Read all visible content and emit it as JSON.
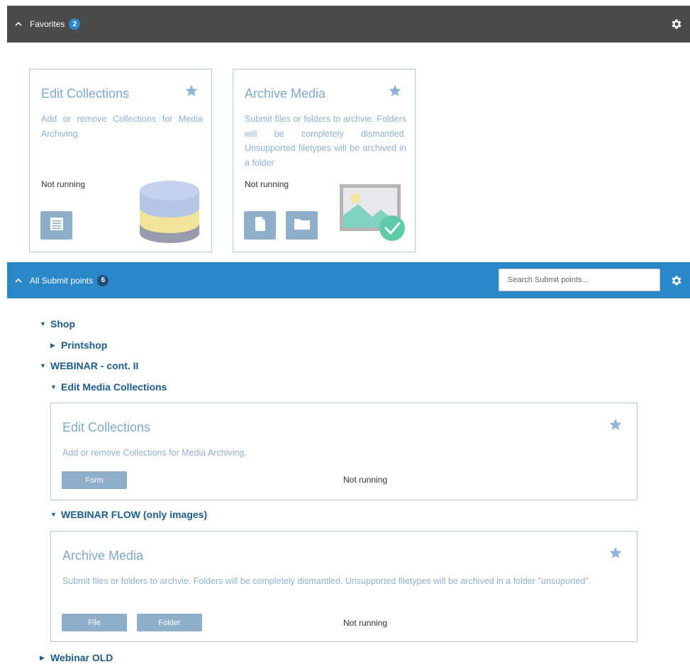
{
  "favorites": {
    "title": "Favorites",
    "count": "2",
    "cards": [
      {
        "title": "Edit Collections",
        "description": "Add or remove Collections for Media Archiving.",
        "status": "Not running",
        "icons": [
          "form-icon"
        ],
        "illustration": "database-illustration"
      },
      {
        "title": "Archive Media",
        "description": "Submit files or folders to archvie. Folders will be completely dismantled. Unsupported filetypes will be archived in a folder",
        "status": "Not running",
        "icons": [
          "file-icon",
          "folder-icon"
        ],
        "illustration": "image-check-illustration"
      }
    ]
  },
  "all": {
    "title": "All Submit points",
    "count": "6",
    "search_placeholder": "Search Submit points..."
  },
  "tree": {
    "shop": "Shop",
    "printshop": "Printshop",
    "webinar_cont": "WEBINAR - cont. II",
    "edit_media_collections": "Edit Media Collections",
    "webinar_flow": "WEBINAR FLOW (only images)",
    "webinar_old": "Webinar OLD"
  },
  "list_cards": [
    {
      "title": "Edit Collections",
      "description": "Add or remove Collections for Media Archiving.",
      "buttons": [
        "Form"
      ],
      "status": "Not running"
    },
    {
      "title": "Archive Media",
      "description": "Submit files or folders to archvie. Folders will be completely dismantled. Unsupported filetypes will be archived in a folder \"unsuported\".",
      "buttons": [
        "File",
        "Folder"
      ],
      "status": "Not running"
    }
  ],
  "colors": {
    "favorites_bar": "#4a4a4a",
    "submit_bar": "#2a88c8",
    "card_title": "#7fa8cb",
    "tree_text": "#1d5c8c",
    "button": "#8eaeca"
  }
}
